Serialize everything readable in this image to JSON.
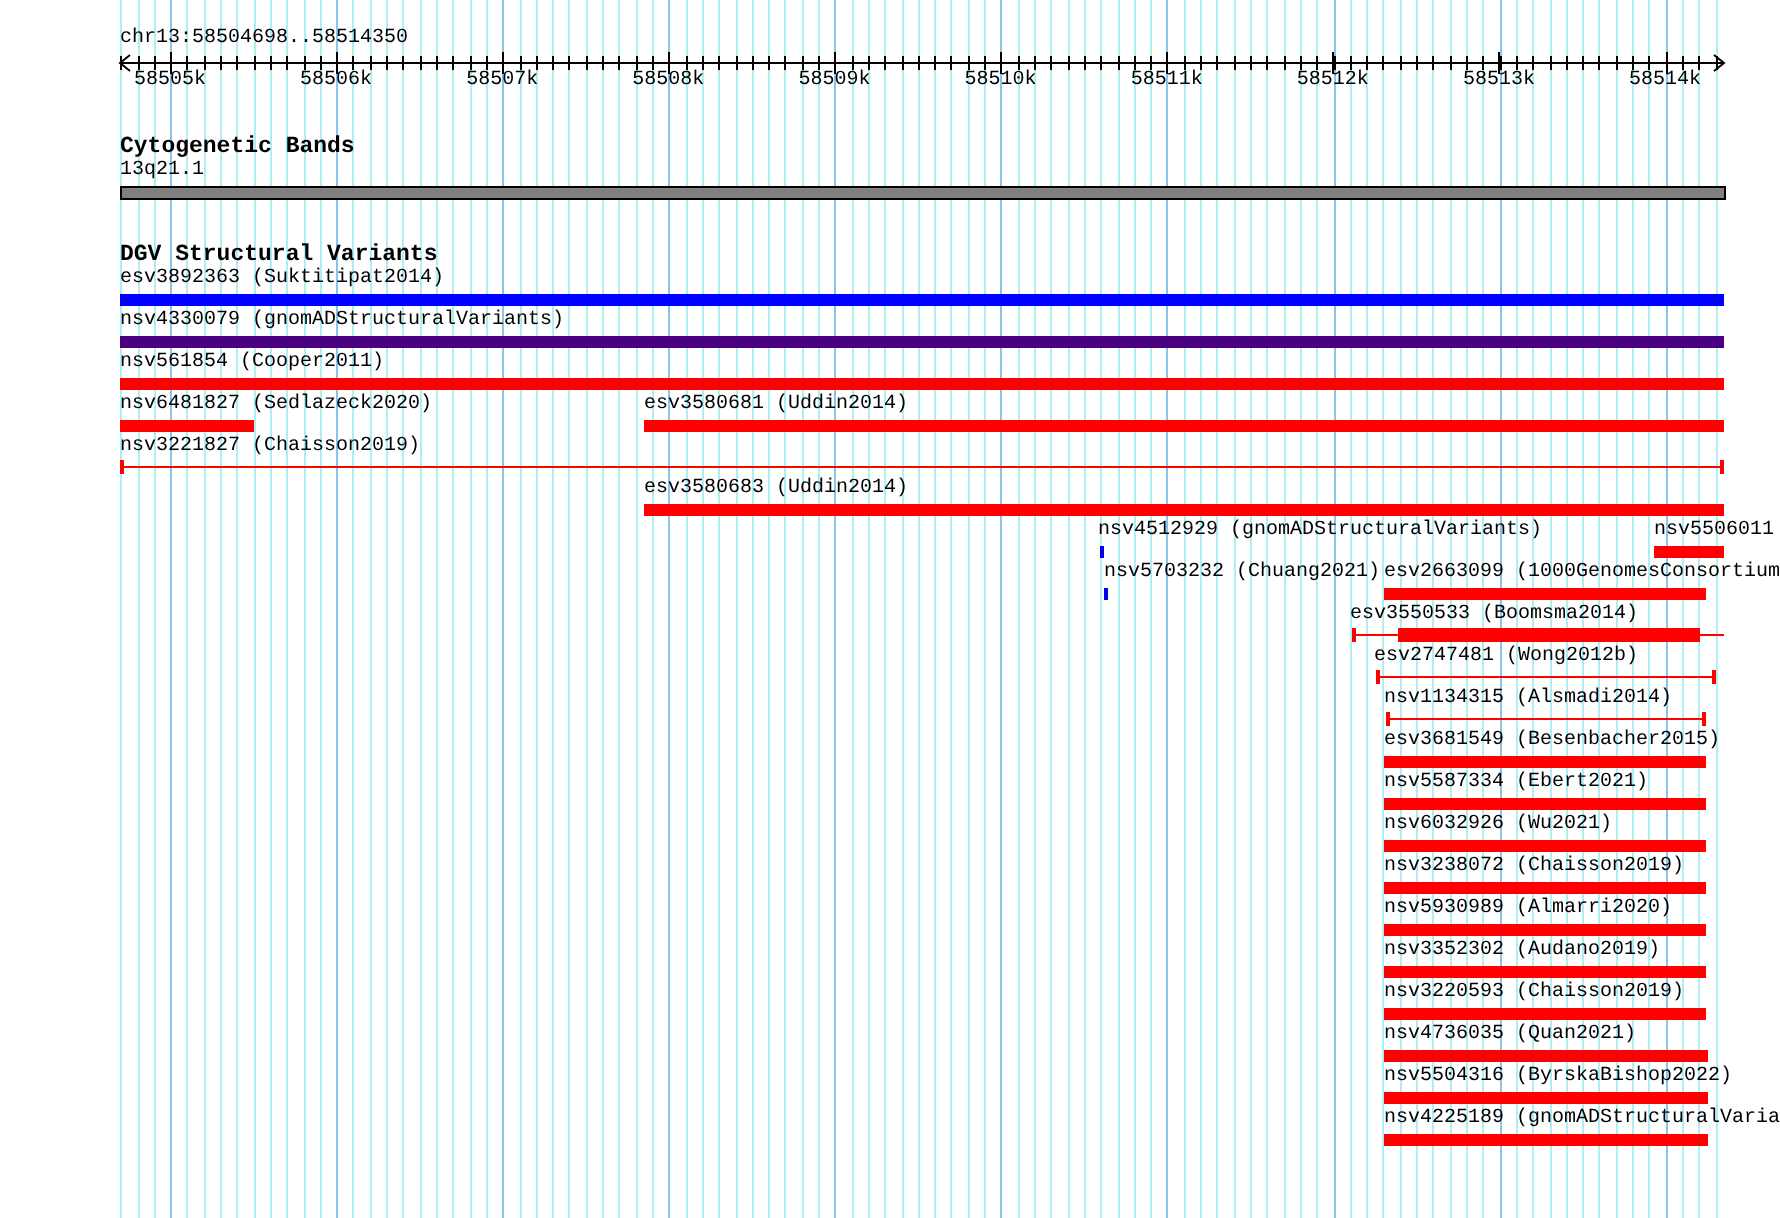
{
  "ruler": {
    "location": "chr13:58504698..58514350",
    "ticks": [
      "58505k",
      "58506k",
      "58507k",
      "58508k",
      "58509k",
      "58510k",
      "58511k",
      "58512k",
      "58513k",
      "58514k"
    ]
  },
  "tracks": [
    {
      "title": "Cytogenetic Bands",
      "features": [
        {
          "label": "13q21.1",
          "kind": "band"
        }
      ]
    },
    {
      "title": "DGV Structural Variants",
      "features": [
        {
          "label": "esv3892363 (Suktitipat2014)",
          "kind": "bar",
          "color": "#0000ff"
        },
        {
          "label": "nsv4330079 (gnomADStructuralVariants)",
          "kind": "bar",
          "color": "#4b0082"
        },
        {
          "label": "nsv561854 (Cooper2011)",
          "kind": "bar",
          "color": "#ff0000"
        },
        {
          "label": "nsv6481827 (Sedlazeck2020)",
          "kind": "bar",
          "color": "#ff0000"
        },
        {
          "label": "esv3580681 (Uddin2014)",
          "kind": "bar",
          "color": "#ff0000"
        },
        {
          "label": "nsv3221827 (Chaisson2019)",
          "kind": "span",
          "color": "#ff0000"
        },
        {
          "label": "esv3580683 (Uddin2014)",
          "kind": "bar",
          "color": "#ff0000"
        },
        {
          "label": "nsv4512929 (gnomADStructuralVariants)",
          "kind": "bar",
          "color": "#0000ff"
        },
        {
          "label": "nsv5506011",
          "kind": "bar",
          "color": "#ff0000"
        },
        {
          "label": "nsv5703232 (Chuang2021)",
          "kind": "bar",
          "color": "#0000ff"
        },
        {
          "label": "esv2663099 (1000GenomesConsortium",
          "kind": "bar",
          "color": "#ff0000"
        },
        {
          "label": "esv3550533 (Boomsma2014)",
          "kind": "bar-with-span",
          "color": "#ff0000"
        },
        {
          "label": "esv2747481 (Wong2012b)",
          "kind": "span",
          "color": "#ff0000"
        },
        {
          "label": "nsv1134315 (Alsmadi2014)",
          "kind": "span",
          "color": "#ff0000"
        },
        {
          "label": "esv3681549 (Besenbacher2015)",
          "kind": "bar",
          "color": "#ff0000"
        },
        {
          "label": "nsv5587334 (Ebert2021)",
          "kind": "bar",
          "color": "#ff0000"
        },
        {
          "label": "nsv6032926 (Wu2021)",
          "kind": "bar",
          "color": "#ff0000"
        },
        {
          "label": "nsv3238072 (Chaisson2019)",
          "kind": "bar",
          "color": "#ff0000"
        },
        {
          "label": "nsv5930989 (Almarri2020)",
          "kind": "bar",
          "color": "#ff0000"
        },
        {
          "label": "nsv3352302 (Audano2019)",
          "kind": "bar",
          "color": "#ff0000"
        },
        {
          "label": "nsv3220593 (Chaisson2019)",
          "kind": "bar",
          "color": "#ff0000"
        },
        {
          "label": "nsv4736035 (Quan2021)",
          "kind": "bar",
          "color": "#ff0000"
        },
        {
          "label": "nsv5504316 (ByrskaBishop2022)",
          "kind": "bar",
          "color": "#ff0000"
        },
        {
          "label": "nsv4225189 (gnomADStructuralVaria",
          "kind": "bar",
          "color": "#ff0000"
        }
      ]
    }
  ]
}
